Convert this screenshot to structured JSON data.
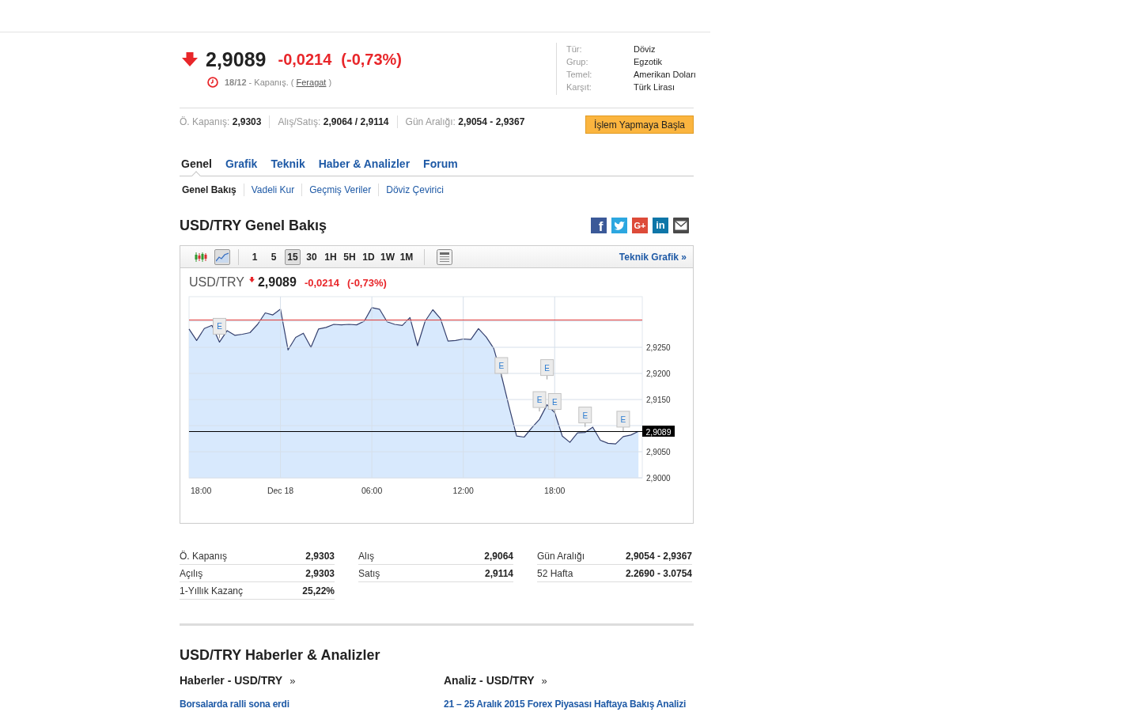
{
  "quote": {
    "price_down": true,
    "price": "2,9089",
    "change": "-0,0214",
    "change_pct": "(-0,73%)",
    "note": {
      "time": "18/12",
      "text": "- Kapanış. (",
      "link": "Feragat",
      "after": ")"
    }
  },
  "info": [
    {
      "label": "Tür:",
      "value": "Döviz"
    },
    {
      "label": "Grup:",
      "value": "Egzotik"
    },
    {
      "label": "Temel:",
      "value": "Amerikan Doları"
    },
    {
      "label": "Karşıt:",
      "value": "Türk Lirası"
    }
  ],
  "summary": [
    {
      "label": "Ö. Kapanış:",
      "value": "2,9303"
    },
    {
      "label": "Alış/Satış:",
      "value": "2,9064 / 2,9114"
    },
    {
      "label": "Gün Aralığı:",
      "value": "2,9054 - 2,9367"
    }
  ],
  "trade_button": "İşlem Yapmaya Başla",
  "tabs": [
    {
      "label": "Genel",
      "selected": true
    },
    {
      "label": "Grafik",
      "selected": false
    },
    {
      "label": "Teknik",
      "selected": false
    },
    {
      "label": "Haber & Analizler",
      "selected": false
    },
    {
      "label": "Forum",
      "selected": false
    }
  ],
  "subtabs": [
    {
      "label": "Genel Bakış",
      "selected": true
    },
    {
      "label": "Vadeli Kur",
      "selected": false
    },
    {
      "label": "Geçmiş Veriler",
      "selected": false
    },
    {
      "label": "Döviz Çevirici",
      "selected": false
    }
  ],
  "section_title": "USD/TRY Genel Bakış",
  "share_buttons": [
    {
      "kind": "facebook",
      "label": "f"
    },
    {
      "kind": "twitter"
    },
    {
      "kind": "google_plus",
      "label": "G+"
    },
    {
      "kind": "linkedin",
      "label": "in"
    },
    {
      "kind": "email"
    }
  ],
  "chart_panel": {
    "chart_types": [
      {
        "kind": "candlestick",
        "selected": false
      },
      {
        "kind": "line",
        "selected": true
      }
    ],
    "intervals": [
      {
        "label": "1",
        "selected": false
      },
      {
        "label": "5",
        "selected": false
      },
      {
        "label": "15",
        "selected": true
      },
      {
        "label": "30",
        "selected": false
      },
      {
        "label": "1H",
        "selected": false
      },
      {
        "label": "5H",
        "selected": false
      },
      {
        "label": "1D",
        "selected": false
      },
      {
        "label": "1W",
        "selected": false
      },
      {
        "label": "1M",
        "selected": false
      }
    ],
    "technical_link": "Teknik Grafik »",
    "header": {
      "symbol": "USD/TRY",
      "price_down": true,
      "price": "2,9089",
      "change": "-0,0214",
      "change_pct": "(-0,73%)"
    },
    "chart": {
      "y_axis_labels": [
        "2,9250",
        "2,9200",
        "2,9150",
        "2,9050",
        "2,9000"
      ],
      "x_axis_labels": [
        "18:00",
        "Dec 18",
        "06:00",
        "12:00",
        "18:00"
      ],
      "level_lines": [
        {
          "color": "#e03a3a"
        },
        {
          "color": "#000000",
          "label": "2,9089"
        }
      ],
      "event_flags": [
        "E",
        "E",
        "E",
        "E",
        "E",
        "E",
        "E"
      ]
    }
  },
  "stats": [
    {
      "rows": [
        {
          "label": "Ö. Kapanış",
          "value": "2,9303"
        },
        {
          "label": "Açılış",
          "value": "2,9303"
        },
        {
          "label": "1-Yıllık Kazanç",
          "value": "25,22%"
        }
      ]
    },
    {
      "rows": [
        {
          "label": "Alış",
          "value": "2,9064"
        },
        {
          "label": "Satış",
          "value": "2,9114"
        }
      ]
    },
    {
      "rows": [
        {
          "label": "Gün Aralığı",
          "value": "2,9054 - 2,9367"
        },
        {
          "label": "52 Hafta",
          "value": "2.2690 - 3.0754"
        }
      ]
    }
  ],
  "news_section": {
    "title": "USD/TRY Haberler & Analizler",
    "columns": [
      {
        "title": "Haberler - USD/TRY",
        "arrow": "»",
        "items": [
          "Borsalarda ralli sona erdi"
        ]
      },
      {
        "title": "Analiz - USD/TRY",
        "arrow": "»",
        "items": [
          "21 – 25 Aralık 2015 Forex Piyasası Haftaya Bakış Analizi"
        ]
      }
    ]
  }
}
